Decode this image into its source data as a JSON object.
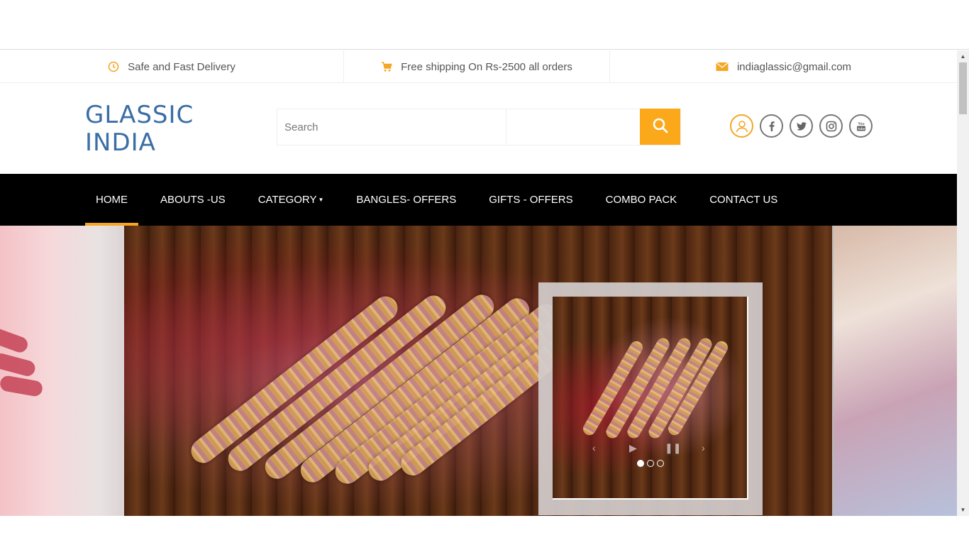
{
  "info_bar": {
    "delivery": "Safe and Fast Delivery",
    "shipping": "Free shipping On Rs-2500 all orders",
    "email": "indiaglassic@gmail.com"
  },
  "header": {
    "logo_line1": "GLASSIC",
    "logo_line2": "INDIA",
    "search_placeholder": "Search",
    "social_icons": [
      "user-icon",
      "facebook-icon",
      "twitter-icon",
      "instagram-icon",
      "youtube-icon"
    ]
  },
  "nav": {
    "items": [
      "HOME",
      "ABOUTS -US",
      "CATEGORY",
      "BANGLES- OFFERS",
      "GIFTS - OFFERS",
      "COMBO PACK",
      "CONTACT US"
    ],
    "active": "HOME"
  },
  "slider": {
    "slide_count": 3,
    "active_slide": 1
  },
  "colors": {
    "accent": "#fba81b",
    "logo": "#3a6ea5",
    "nav_bg": "#000000"
  }
}
